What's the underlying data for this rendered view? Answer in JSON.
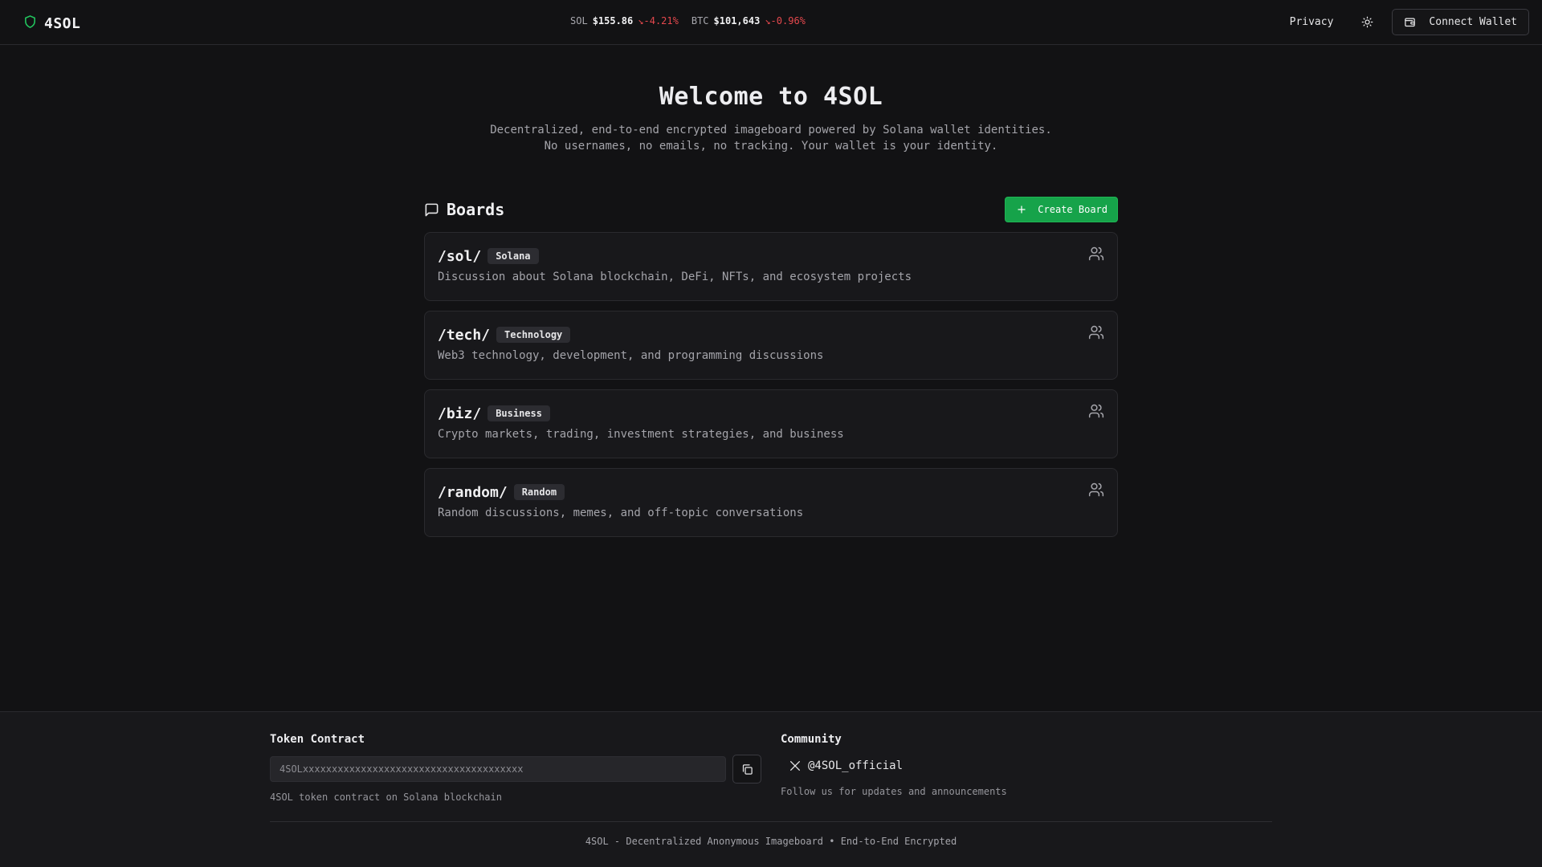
{
  "header": {
    "logo_text": "4SOL",
    "ticker": [
      {
        "symbol": "SOL",
        "price": "$155.86",
        "change": "↘-4.21%"
      },
      {
        "symbol": "BTC",
        "price": "$101,643",
        "change": "↘-0.96%"
      }
    ],
    "privacy_label": "Privacy",
    "connect_wallet_label": "Connect Wallet"
  },
  "hero": {
    "title": "Welcome to 4SOL",
    "subtitle": "Decentralized, end-to-end encrypted imageboard powered by Solana wallet identities. No usernames, no emails, no tracking. Your wallet is your identity."
  },
  "boards": {
    "title": "Boards",
    "create_label": "Create Board",
    "items": [
      {
        "slug": "/sol/",
        "badge": "Solana",
        "description": "Discussion about Solana blockchain, DeFi, NFTs, and ecosystem projects"
      },
      {
        "slug": "/tech/",
        "badge": "Technology",
        "description": "Web3 technology, development, and programming discussions"
      },
      {
        "slug": "/biz/",
        "badge": "Business",
        "description": "Crypto markets, trading, investment strategies, and business"
      },
      {
        "slug": "/random/",
        "badge": "Random",
        "description": "Random discussions, memes, and off-topic conversations"
      }
    ]
  },
  "footer": {
    "token_heading": "Token Contract",
    "contract_value": "4SOLxxxxxxxxxxxxxxxxxxxxxxxxxxxxxxxxxxxxxx",
    "token_note": "4SOL token contract on Solana blockchain",
    "community_heading": "Community",
    "social_handle": "@4SOL_official",
    "community_note": "Follow us for updates and announcements",
    "bottom_text": "4SOL - Decentralized Anonymous Imageboard • End-to-End Encrypted"
  },
  "colors": {
    "background": "#121214",
    "accent_green": "#16a34a",
    "negative_red": "#e5484d"
  }
}
